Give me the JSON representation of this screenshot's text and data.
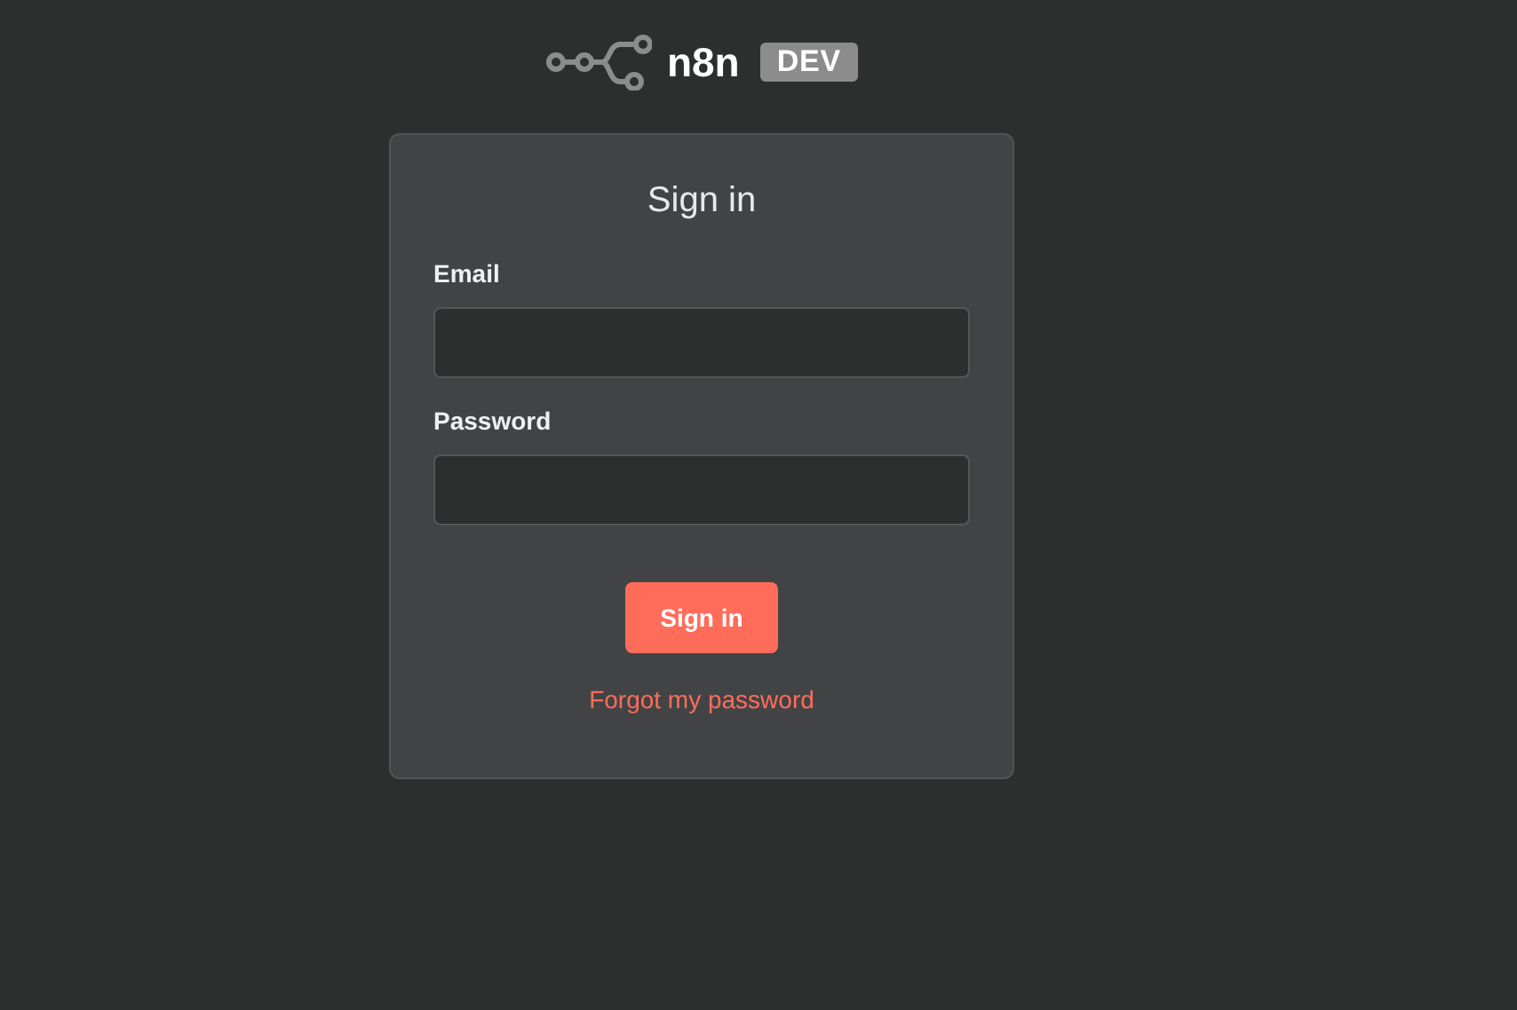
{
  "logo": {
    "name": "n8n",
    "badge": "DEV"
  },
  "card": {
    "title": "Sign in",
    "fields": [
      {
        "label": "Email"
      },
      {
        "label": "Password"
      }
    ],
    "submit": "Sign in",
    "forgot_link": "Forgot my password"
  }
}
